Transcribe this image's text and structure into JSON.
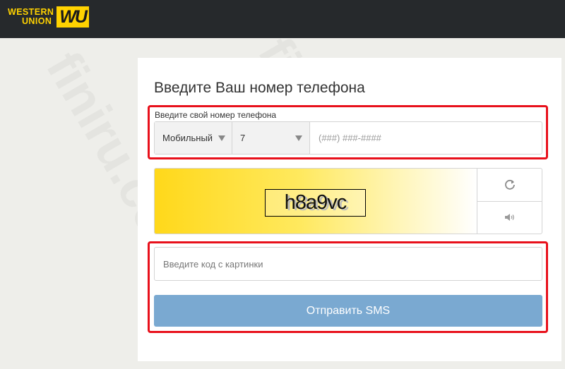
{
  "header": {
    "logo_line1": "WESTERN",
    "logo_line2": "UNION",
    "logo_mark": "WU",
    "bg_color": "#26292c",
    "brand_color": "#ffd200"
  },
  "form": {
    "title": "Введите Ваш номер телефона",
    "phone_label": "Введите свой номер телефона",
    "phone_type": "Мобильный",
    "country_code": "7",
    "phone_placeholder": "(###) ###-####",
    "captcha_text": "h8a9vc",
    "refresh_icon": "refresh-icon",
    "audio_icon": "speaker-icon",
    "code_placeholder": "Введите код с картинки",
    "send_label": "Отправить SMS",
    "send_color": "#7aa9d1",
    "highlight_color": "#e8101b"
  },
  "watermark": {
    "text": "finiru.com"
  }
}
